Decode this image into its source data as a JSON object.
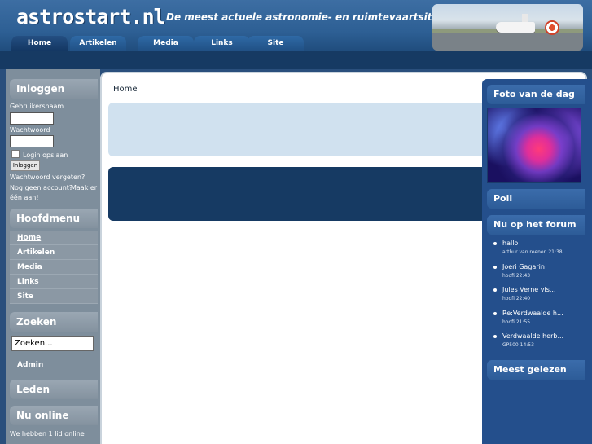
{
  "header": {
    "logo": "astrostart.nl",
    "tagline": "De meest actuele astronomie- en ruimtevaartsite van de Benelux!"
  },
  "nav": {
    "tabs": [
      {
        "label": "Home",
        "active": true
      },
      {
        "label": "Artikelen",
        "active": false
      },
      {
        "label": "Media",
        "active": false
      },
      {
        "label": "Links",
        "active": false
      },
      {
        "label": "Site",
        "active": false
      }
    ]
  },
  "login": {
    "title": "Inloggen",
    "username_label": "Gebruikersnaam",
    "password_label": "Wachtwoord",
    "remember_label": "Login opslaan",
    "submit_label": "Inloggen",
    "forgot_link": "Wachtwoord vergeten?",
    "register_text": "Nog geen account?",
    "register_link_1": "Maak er",
    "register_link_2": "één aan!"
  },
  "mainmenu": {
    "title": "Hoofdmenu",
    "items": [
      "Home",
      "Artikelen",
      "Media",
      "Links",
      "Site"
    ]
  },
  "search": {
    "title": "Zoeken",
    "placeholder": "Zoeken...",
    "admin_label": "Admin"
  },
  "members": {
    "title": "Leden"
  },
  "online": {
    "title": "Nu online",
    "text": "We hebben 1 lid online"
  },
  "main": {
    "breadcrumb": "Home"
  },
  "right": {
    "photo_title": "Foto van de dag",
    "poll_title": "Poll",
    "forum_title": "Nu op het forum",
    "forum_items": [
      {
        "title": "hallo",
        "meta": "arthur van reenen 21:38"
      },
      {
        "title": "Joeri Gagarin",
        "meta": "hoofi 22:43"
      },
      {
        "title": "Jules Verne vis...",
        "meta": "hoofi 22:40"
      },
      {
        "title": "Re:Verdwaalde h...",
        "meta": "hoofi 21:55"
      },
      {
        "title": "Verdwaalde herb...",
        "meta": "GP500 14:53"
      }
    ],
    "popular_title": "Meest gelezen"
  }
}
